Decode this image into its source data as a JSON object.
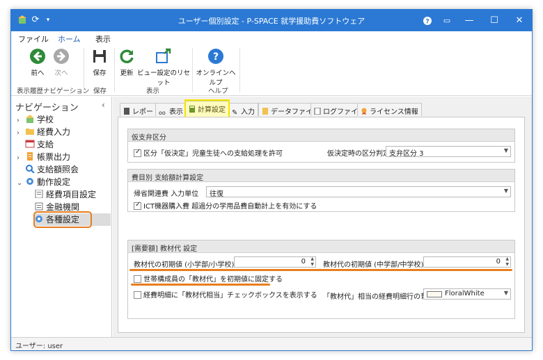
{
  "window": {
    "title": "ユーザー個別設定 - P-SPACE 就学援助費ソフトウェア"
  },
  "menu": {
    "file": "ファイル",
    "home": "ホーム",
    "view": "表示"
  },
  "ribbon": {
    "back": "前へ",
    "forward": "次へ",
    "save": "保存",
    "refresh": "更新",
    "reset_view": "ビュー設定のリセット",
    "online_help": "オンラインヘルプ",
    "group_history": "表示履歴ナビゲーション",
    "group_save": "保存",
    "group_view": "表示",
    "group_help": "ヘルプ"
  },
  "nav": {
    "title": "ナビゲーション",
    "collapse": "‹",
    "items": [
      {
        "label": "学校"
      },
      {
        "label": "経費入力"
      },
      {
        "label": "支給"
      },
      {
        "label": "帳票出力"
      },
      {
        "label": "支給額照会"
      },
      {
        "label": "動作設定"
      },
      {
        "label": "経費項目設定"
      },
      {
        "label": "金融機関"
      },
      {
        "label": "各種設定"
      }
    ]
  },
  "tabs": {
    "report": "レポート",
    "display": "表示",
    "calc": "計算設定",
    "input": "入力",
    "datafile": "データファイル",
    "logfile": "ログファイル",
    "license": "ライセンス情報"
  },
  "groups": {
    "provisional": {
      "head": "仮支弁区分",
      "allow_label": "区分「仮決定」児童生徒への支給処理を許可",
      "allow_checked": true,
      "category_label": "仮決定時の区分判定",
      "category_value": "支弁区分 3"
    },
    "expense_calc": {
      "head": "費目別 支給額計算設定",
      "unit_label": "帰省関連費 入力単位",
      "unit_value": "往復",
      "ict_label": "ICT機器購入費 超過分の学用品費自動計上を有効にする",
      "ict_checked": true
    },
    "materials": {
      "head": "[需要額] 教材代 設定",
      "elem_label": "教材代の初期値 (小学部/小学校)",
      "elem_value": "0",
      "mid_label": "教材代の初期値 (中学部/中学校)",
      "mid_value": "0",
      "fix_label": "世帯構成員の「教材代」を初期値に固定する",
      "fix_checked": false,
      "show_label": "経費明細に「教材代相当」チェックボックスを表示する",
      "show_checked": false,
      "bg_label": "「教材代」相当の経費明細行の背景色",
      "bg_value": "FloralWhite",
      "bg_color": "#FFFAF0"
    }
  },
  "status": {
    "user": "ユーザー: user"
  },
  "colors": {
    "accent": "#2b79d4",
    "highlight_orange": "#e87d1e",
    "highlight_yellow": "#f5e400"
  }
}
